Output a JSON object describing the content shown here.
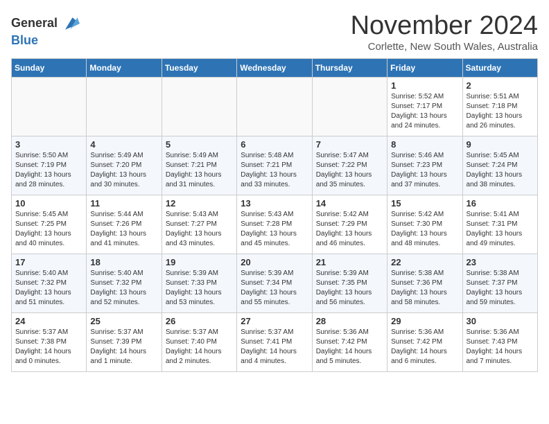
{
  "header": {
    "logo_line1": "General",
    "logo_line2": "Blue",
    "month": "November 2024",
    "location": "Corlette, New South Wales, Australia"
  },
  "weekdays": [
    "Sunday",
    "Monday",
    "Tuesday",
    "Wednesday",
    "Thursday",
    "Friday",
    "Saturday"
  ],
  "weeks": [
    [
      {
        "day": "",
        "info": ""
      },
      {
        "day": "",
        "info": ""
      },
      {
        "day": "",
        "info": ""
      },
      {
        "day": "",
        "info": ""
      },
      {
        "day": "",
        "info": ""
      },
      {
        "day": "1",
        "info": "Sunrise: 5:52 AM\nSunset: 7:17 PM\nDaylight: 13 hours\nand 24 minutes."
      },
      {
        "day": "2",
        "info": "Sunrise: 5:51 AM\nSunset: 7:18 PM\nDaylight: 13 hours\nand 26 minutes."
      }
    ],
    [
      {
        "day": "3",
        "info": "Sunrise: 5:50 AM\nSunset: 7:19 PM\nDaylight: 13 hours\nand 28 minutes."
      },
      {
        "day": "4",
        "info": "Sunrise: 5:49 AM\nSunset: 7:20 PM\nDaylight: 13 hours\nand 30 minutes."
      },
      {
        "day": "5",
        "info": "Sunrise: 5:49 AM\nSunset: 7:21 PM\nDaylight: 13 hours\nand 31 minutes."
      },
      {
        "day": "6",
        "info": "Sunrise: 5:48 AM\nSunset: 7:21 PM\nDaylight: 13 hours\nand 33 minutes."
      },
      {
        "day": "7",
        "info": "Sunrise: 5:47 AM\nSunset: 7:22 PM\nDaylight: 13 hours\nand 35 minutes."
      },
      {
        "day": "8",
        "info": "Sunrise: 5:46 AM\nSunset: 7:23 PM\nDaylight: 13 hours\nand 37 minutes."
      },
      {
        "day": "9",
        "info": "Sunrise: 5:45 AM\nSunset: 7:24 PM\nDaylight: 13 hours\nand 38 minutes."
      }
    ],
    [
      {
        "day": "10",
        "info": "Sunrise: 5:45 AM\nSunset: 7:25 PM\nDaylight: 13 hours\nand 40 minutes."
      },
      {
        "day": "11",
        "info": "Sunrise: 5:44 AM\nSunset: 7:26 PM\nDaylight: 13 hours\nand 41 minutes."
      },
      {
        "day": "12",
        "info": "Sunrise: 5:43 AM\nSunset: 7:27 PM\nDaylight: 13 hours\nand 43 minutes."
      },
      {
        "day": "13",
        "info": "Sunrise: 5:43 AM\nSunset: 7:28 PM\nDaylight: 13 hours\nand 45 minutes."
      },
      {
        "day": "14",
        "info": "Sunrise: 5:42 AM\nSunset: 7:29 PM\nDaylight: 13 hours\nand 46 minutes."
      },
      {
        "day": "15",
        "info": "Sunrise: 5:42 AM\nSunset: 7:30 PM\nDaylight: 13 hours\nand 48 minutes."
      },
      {
        "day": "16",
        "info": "Sunrise: 5:41 AM\nSunset: 7:31 PM\nDaylight: 13 hours\nand 49 minutes."
      }
    ],
    [
      {
        "day": "17",
        "info": "Sunrise: 5:40 AM\nSunset: 7:32 PM\nDaylight: 13 hours\nand 51 minutes."
      },
      {
        "day": "18",
        "info": "Sunrise: 5:40 AM\nSunset: 7:32 PM\nDaylight: 13 hours\nand 52 minutes."
      },
      {
        "day": "19",
        "info": "Sunrise: 5:39 AM\nSunset: 7:33 PM\nDaylight: 13 hours\nand 53 minutes."
      },
      {
        "day": "20",
        "info": "Sunrise: 5:39 AM\nSunset: 7:34 PM\nDaylight: 13 hours\nand 55 minutes."
      },
      {
        "day": "21",
        "info": "Sunrise: 5:39 AM\nSunset: 7:35 PM\nDaylight: 13 hours\nand 56 minutes."
      },
      {
        "day": "22",
        "info": "Sunrise: 5:38 AM\nSunset: 7:36 PM\nDaylight: 13 hours\nand 58 minutes."
      },
      {
        "day": "23",
        "info": "Sunrise: 5:38 AM\nSunset: 7:37 PM\nDaylight: 13 hours\nand 59 minutes."
      }
    ],
    [
      {
        "day": "24",
        "info": "Sunrise: 5:37 AM\nSunset: 7:38 PM\nDaylight: 14 hours\nand 0 minutes."
      },
      {
        "day": "25",
        "info": "Sunrise: 5:37 AM\nSunset: 7:39 PM\nDaylight: 14 hours\nand 1 minute."
      },
      {
        "day": "26",
        "info": "Sunrise: 5:37 AM\nSunset: 7:40 PM\nDaylight: 14 hours\nand 2 minutes."
      },
      {
        "day": "27",
        "info": "Sunrise: 5:37 AM\nSunset: 7:41 PM\nDaylight: 14 hours\nand 4 minutes."
      },
      {
        "day": "28",
        "info": "Sunrise: 5:36 AM\nSunset: 7:42 PM\nDaylight: 14 hours\nand 5 minutes."
      },
      {
        "day": "29",
        "info": "Sunrise: 5:36 AM\nSunset: 7:42 PM\nDaylight: 14 hours\nand 6 minutes."
      },
      {
        "day": "30",
        "info": "Sunrise: 5:36 AM\nSunset: 7:43 PM\nDaylight: 14 hours\nand 7 minutes."
      }
    ]
  ]
}
